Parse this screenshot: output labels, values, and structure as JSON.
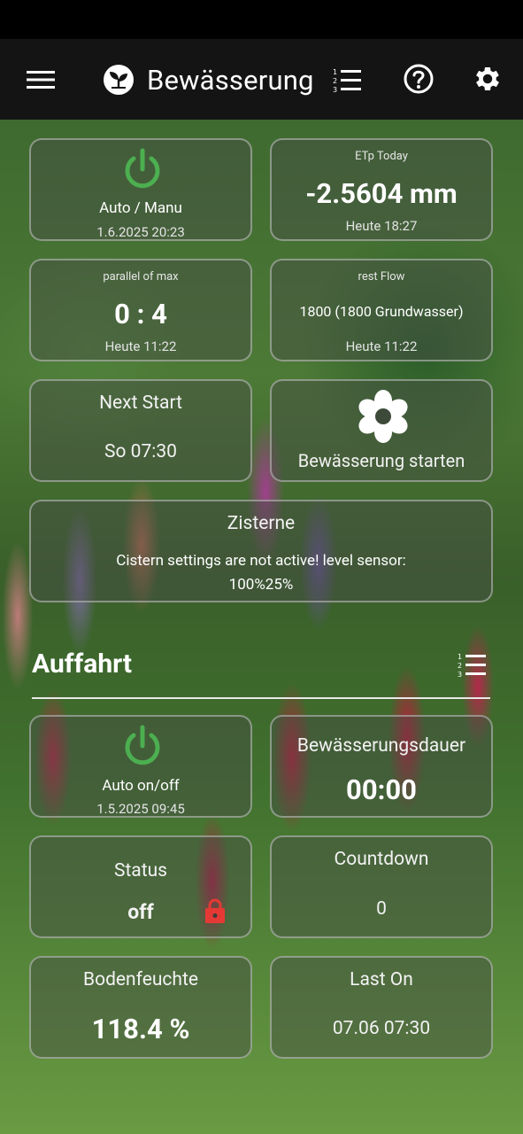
{
  "app": {
    "title": "Bewässerung"
  },
  "icons": {
    "menu": "menu-icon",
    "logo": "sprout-logo-icon",
    "list": "numbered-list-icon",
    "help": "help-circle-icon",
    "settings": "gear-icon",
    "power": "power-icon",
    "flower": "flower-icon",
    "lock": "lock-icon"
  },
  "colors": {
    "accent_green": "#4caf50",
    "lock_red": "#e53935",
    "appbar": "#141414"
  },
  "overview": {
    "auto_manu": {
      "label": "Auto / Manu",
      "timestamp": "1.6.2025 20:23"
    },
    "etp": {
      "label": "ETp Today",
      "value": "-2.5604 mm",
      "timestamp": "Heute 18:27"
    },
    "parallel": {
      "label": "parallel of max",
      "value": "0 : 4",
      "timestamp": "Heute 11:22"
    },
    "rest_flow": {
      "label": "rest Flow",
      "value": "1800 (1800 Grundwasser)",
      "timestamp": "Heute 11:22"
    },
    "next_start": {
      "label": "Next Start",
      "value": "So 07:30"
    },
    "start_button": {
      "label": "Bewässerung starten"
    },
    "zisterne": {
      "label": "Zisterne",
      "message_line1": "Cistern settings are not active! level sensor:",
      "message_line2": "100%25%"
    }
  },
  "zone": {
    "name": "Auffahrt",
    "auto": {
      "label": "Auto on/off",
      "timestamp": "1.5.2025 09:45"
    },
    "duration": {
      "label": "Bewässerungsdauer",
      "value": "00:00"
    },
    "status": {
      "label": "Status",
      "value": "off"
    },
    "countdown": {
      "label": "Countdown",
      "value": "0"
    },
    "soil": {
      "label": "Bodenfeuchte",
      "value": "118.4 %"
    },
    "last_on": {
      "label": "Last On",
      "value": "07.06 07:30"
    }
  }
}
